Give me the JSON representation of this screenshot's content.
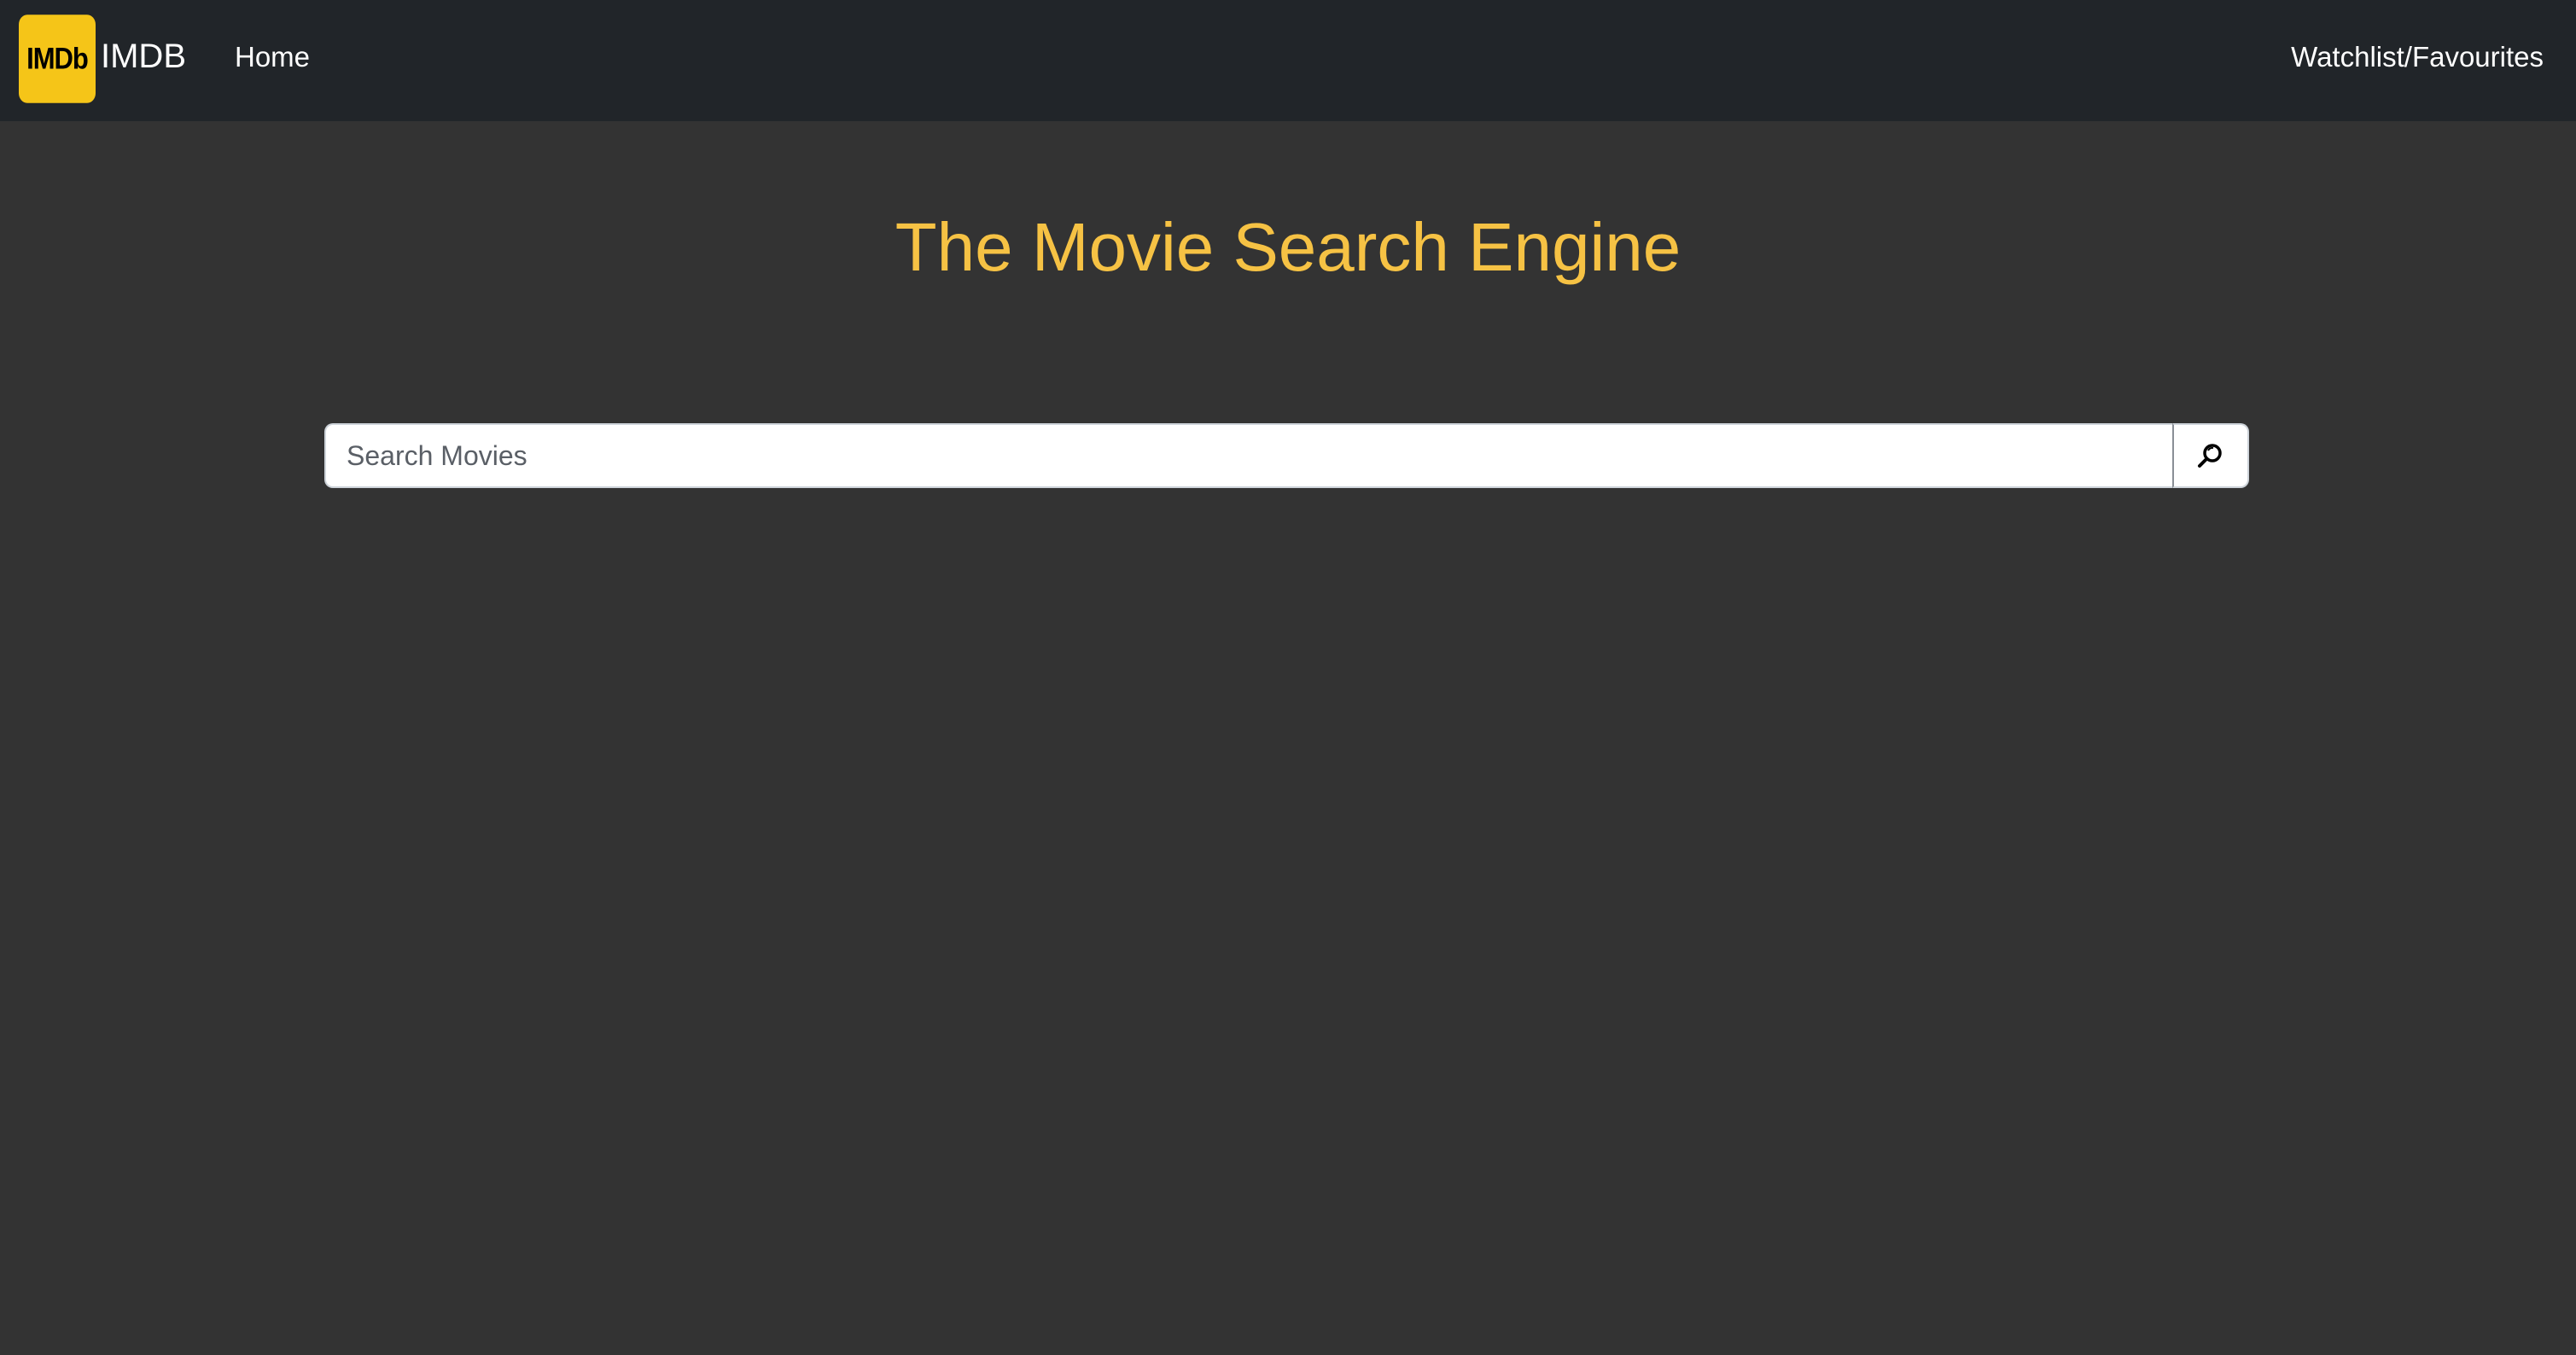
{
  "navbar": {
    "logo_text": "IMDb",
    "brand_text": "IMDB",
    "home_label": "Home",
    "watchlist_label": "Watchlist/Favourites"
  },
  "main": {
    "title": "The Movie Search Engine",
    "search": {
      "placeholder": "Search Movies",
      "value": "",
      "button_icon": "search-icon"
    }
  },
  "colors": {
    "navbar_bg": "#212529",
    "page_bg": "#333333",
    "accent": "#f6c244",
    "logo_bg": "#f5c518"
  }
}
